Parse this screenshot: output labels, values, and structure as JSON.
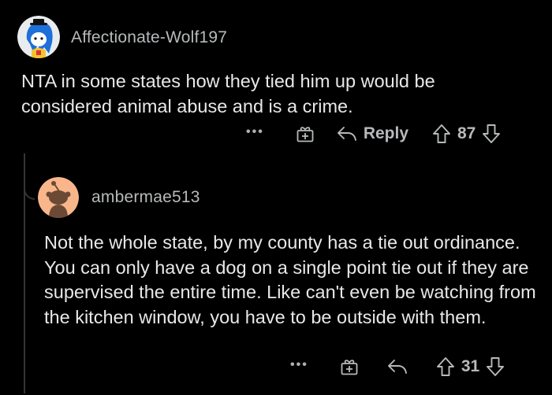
{
  "comments": [
    {
      "username": "Affectionate-Wolf197",
      "avatar_icon": "snoo-avatar-blue-hair",
      "body": "NTA in some states how they tied him up would be considered animal abuse and is a crime.",
      "actions": {
        "more_label": "•••",
        "award_icon": "gift-icon",
        "reply_label": "Reply",
        "upvote_icon": "arrow-up-icon",
        "score": "87",
        "downvote_icon": "arrow-down-icon"
      }
    },
    {
      "username": "ambermae513",
      "avatar_icon": "default-snoo-avatar",
      "body": "Not the whole state, by my county has a tie out ordinance. You can only have a dog on a single point tie out if they are supervised the entire time. Like can't even be watching from the kitchen window, you have to be outside with them.",
      "actions": {
        "more_label": "•••",
        "award_icon": "gift-icon",
        "reply_icon": "reply-arrow-icon",
        "upvote_icon": "arrow-up-icon",
        "score": "31",
        "downvote_icon": "arrow-down-icon"
      }
    }
  ],
  "colors": {
    "background": "#000000",
    "text": "#e8e8e8",
    "meta": "#b7b9bb",
    "thread_line": "#343536"
  }
}
